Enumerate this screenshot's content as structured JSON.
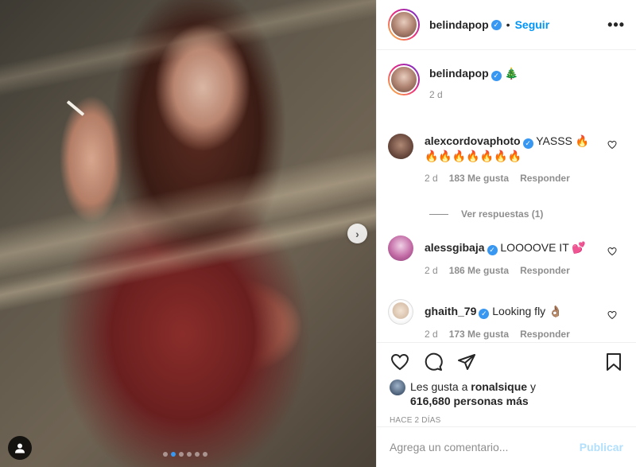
{
  "post": {
    "username": "belindapop",
    "follow_label": "Seguir",
    "separator": "•",
    "more": "•••",
    "image_carousel": {
      "active_index": 1,
      "count": 6
    }
  },
  "caption": {
    "username": "belindapop",
    "emoji": "🎄",
    "time": "2 d"
  },
  "comments": [
    {
      "username": "alexcordovaphoto",
      "text": "YASSS 🔥",
      "text2": "🔥🔥🔥🔥🔥🔥🔥",
      "time": "2 d",
      "likes": "183 Me gusta",
      "reply": "Responder",
      "view_replies": "Ver respuestas (1)"
    },
    {
      "username": "alessgibaja",
      "text": "LOOOOVE IT 💕",
      "time": "2 d",
      "likes": "186 Me gusta",
      "reply": "Responder"
    },
    {
      "username": "ghaith_79",
      "text": "Looking fly 👌🏽",
      "time": "2 d",
      "likes": "173 Me gusta",
      "reply": "Responder"
    }
  ],
  "likes": {
    "prefix": "Les gusta a",
    "user": "ronalsique",
    "suffix": "y",
    "count": "616,680 personas más"
  },
  "timestamp": "HACE 2 DÍAS",
  "comment_box": {
    "placeholder": "Agrega un comentario...",
    "publish": "Publicar"
  },
  "colors": {
    "accent": "#0095f6",
    "verified": "#3897f0",
    "muted": "#8e8e8e",
    "publish_disabled": "#b2dffc"
  }
}
